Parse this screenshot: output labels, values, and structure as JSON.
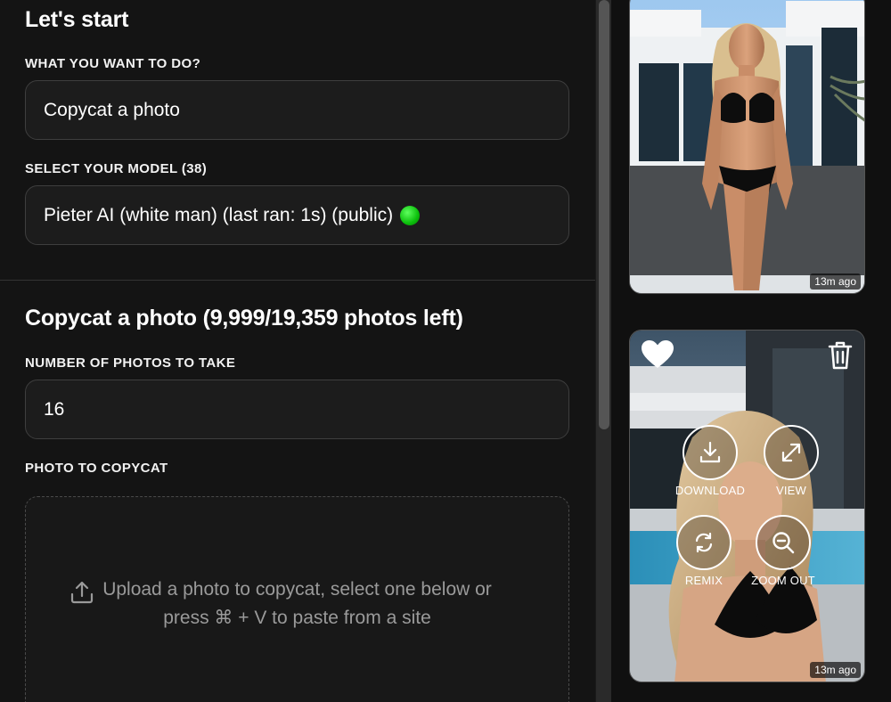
{
  "form": {
    "heading": "Let's start",
    "task_label": "WHAT YOU WANT TO DO?",
    "task_value": "Copycat a photo",
    "model_label": "SELECT YOUR MODEL (38)",
    "model_value": "Pieter AI (white man) (last ran: 1s) (public)",
    "model_status_color": "#0bbf0b"
  },
  "copycat": {
    "heading": "Copycat a photo (9,999/19,359 photos left)",
    "count_label": "NUMBER OF PHOTOS TO TAKE",
    "count_value": "16",
    "photo_label": "PHOTO TO COPYCAT",
    "upload_line1": "Upload a photo to copycat, select one below or",
    "upload_line2": "press ⌘ + V to paste from a site"
  },
  "gallery": {
    "items": [
      {
        "timestamp": "13m ago"
      },
      {
        "timestamp": "13m ago",
        "actions": {
          "download": "DOWNLOAD",
          "view": "VIEW",
          "remix": "REMIX",
          "zoom_out": "ZOOM OUT"
        }
      }
    ]
  },
  "icons": [
    "upload-icon",
    "heart-icon",
    "trash-icon",
    "download-icon",
    "expand-icon",
    "remix-icon",
    "zoom-out-icon"
  ]
}
